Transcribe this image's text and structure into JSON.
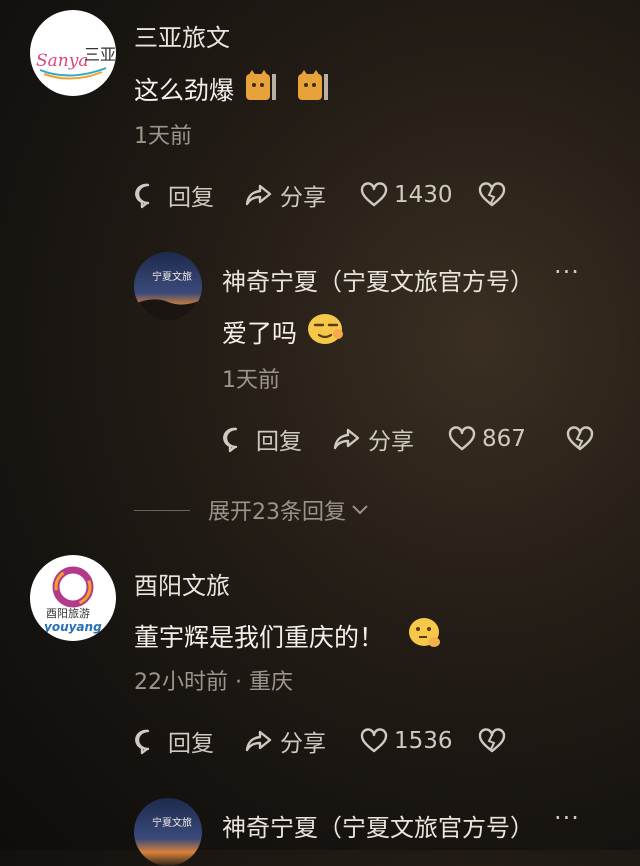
{
  "comments": [
    {
      "author": "三亚旅文",
      "avatar_text": "Sanya",
      "avatar_text2": "三亚",
      "text": "这么劲爆",
      "emoji": [
        "cat-emoji",
        "cat-emoji"
      ],
      "time": "1天前",
      "actions": {
        "reply": "回复",
        "share": "分享",
        "likes": "1430"
      }
    },
    {
      "author": "神奇宁夏（宁夏文旅官方号）",
      "avatar_text": "宁夏文旅",
      "text": "爱了吗",
      "emoji": [
        "smirk-emoji"
      ],
      "time": "1天前",
      "actions": {
        "reply": "回复",
        "share": "分享",
        "likes": "867"
      },
      "more": "···"
    },
    {
      "author": "酉阳文旅",
      "avatar_text": "酉阳旅游",
      "avatar_text2": "youyang",
      "text": "董宇辉是我们重庆的！",
      "emoji": [
        "thinking-emoji"
      ],
      "time": "22小时前 · 重庆",
      "actions": {
        "reply": "回复",
        "share": "分享",
        "likes": "1536"
      }
    },
    {
      "author": "神奇宁夏（宁夏文旅官方号）",
      "avatar_text": "宁夏文旅",
      "more": "···"
    }
  ],
  "expand_replies": "展开23条回复",
  "colors": {
    "accent_orange": "#f2a12b",
    "text": "#f4efe8",
    "muted": "#9c958b"
  }
}
